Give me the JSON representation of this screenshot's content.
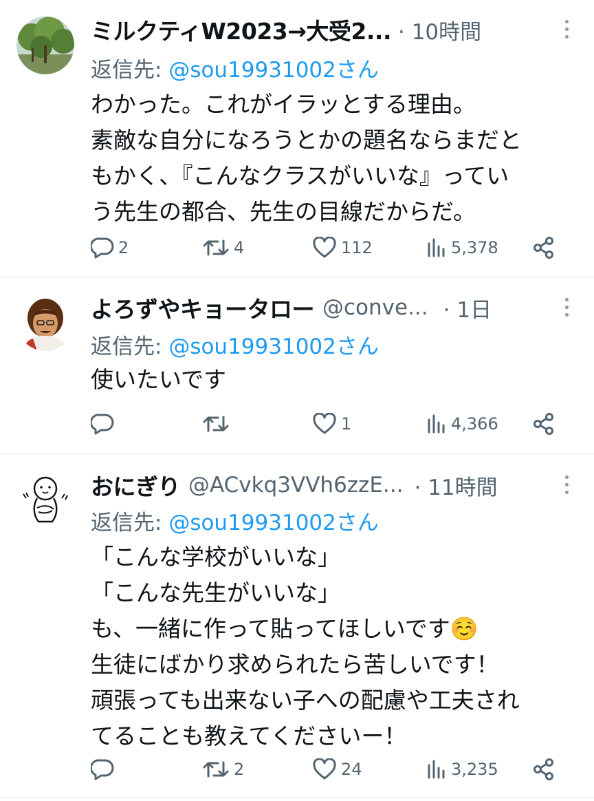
{
  "tweets": [
    {
      "name": "ミルクティW2023→大受2...",
      "handle": "",
      "time": "· 10時間",
      "reply_prefix": "返信先: ",
      "reply_to": "@sou19931002さん",
      "lines": [
        "わかった。これがイラッとする理由。",
        "素敵な自分になろうとかの題名ならまだと",
        "もかく、『こんなクラスがいいな』ってい",
        "う先生の都合、先生の目線だからだ。"
      ],
      "replies": "2",
      "retweets": "4",
      "likes": "112",
      "views": "5,378"
    },
    {
      "name": "よろずやキョータロー",
      "handle": "@conve...",
      "time": "· 1日",
      "reply_prefix": "返信先: ",
      "reply_to": "@sou19931002さん",
      "lines": [
        "使いたいです"
      ],
      "replies": "",
      "retweets": "",
      "likes": "1",
      "views": "4,366"
    },
    {
      "name": "おにぎり",
      "handle": "@ACvkq3VVh6zzE...",
      "time": "· 11時間",
      "reply_prefix": "返信先: ",
      "reply_to": "@sou19931002さん",
      "lines": [
        "「こんな学校がいいな」",
        "「こんな先生がいいな」",
        "も、一緒に作って貼ってほしいです☺️",
        "生徒にばかり求められたら苦しいです！",
        "頑張っても出来ない子への配慮や工夫され",
        "てることも教えてくださいー！"
      ],
      "replies": "",
      "retweets": "2",
      "likes": "24",
      "views": "3,235"
    }
  ],
  "colors": {
    "text": "#0f1419",
    "secondary": "#536471",
    "link": "#1d9bf0",
    "divider": "#eff3f4"
  },
  "icons": [
    "reply-icon",
    "retweet-icon",
    "like-icon",
    "views-icon",
    "share-icon",
    "more-icon"
  ]
}
